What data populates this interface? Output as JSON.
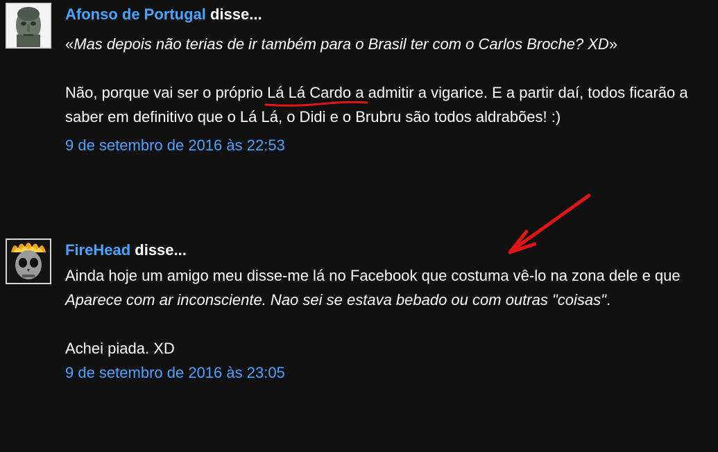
{
  "comments": [
    {
      "author": "Afonso de Portugal",
      "said": " disse...",
      "avatar_icon": "statue-face-avatar",
      "quote_open": "«",
      "quote_text": "Mas depois não terias de ir também para o Brasil ter com o Carlos Broche? XD",
      "quote_close": "»",
      "p2_before": "Não, porque vai ser o próprio ",
      "p2_highlight": "Lá Lá Cardo",
      "p2_after": " a admitir a vigarice. E a partir daí, todos ficarão a saber em definitivo que o Lá Lá, o Didi e o Brubru são todos aldrabões! :)",
      "timestamp": "9 de setembro de 2016 às 22:53"
    },
    {
      "author": "FireHead",
      "said": " disse...",
      "avatar_icon": "flaming-skull-avatar",
      "p1_a": "Ainda hoje um amigo meu disse-me lá no Facebook que costuma vê-lo na zona dele e que ",
      "p1_b": "Aparece com ar inconsciente. Nao sei se estava bebado ou com outras \"coisas\"",
      "p1_c": ".",
      "p2": "Achei piada. XD",
      "timestamp": "9 de setembro de 2016 às 23:05"
    }
  ],
  "annotation_color": "#e01515",
  "link_color": "#4aa3ff",
  "background_color": "#111111"
}
